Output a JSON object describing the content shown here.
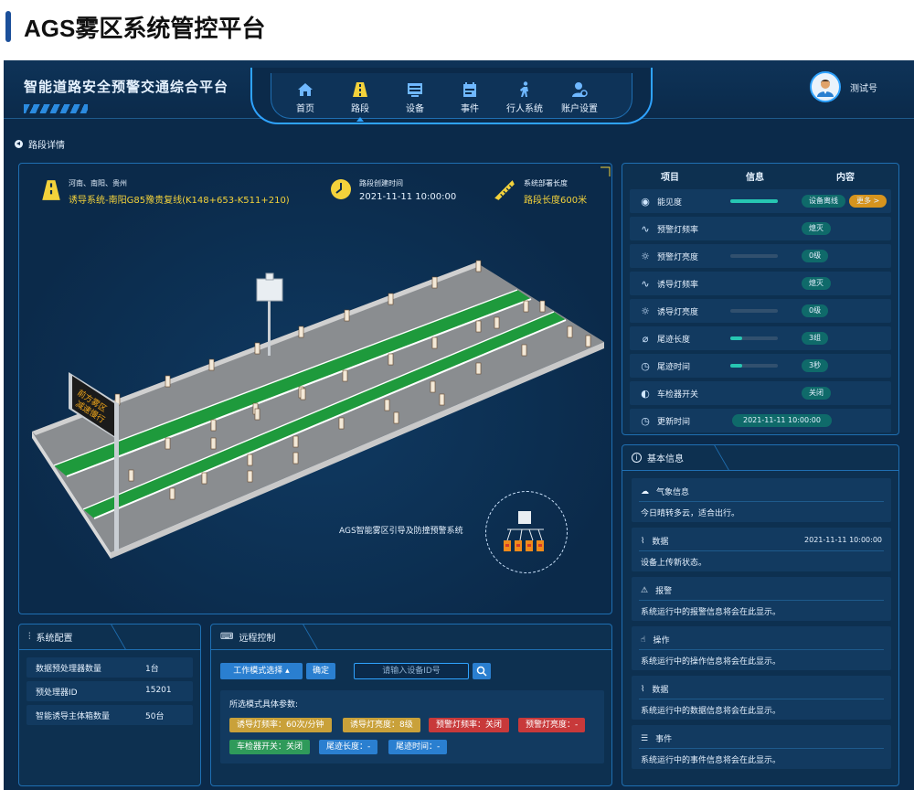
{
  "page_title": "AGS雾区系统管控平台",
  "header": {
    "brand": "智能道路安全预警交通综合平台",
    "nav": [
      {
        "label": "首页",
        "icon": "home-icon"
      },
      {
        "label": "路段",
        "icon": "road-icon",
        "active": true
      },
      {
        "label": "设备",
        "icon": "device-icon"
      },
      {
        "label": "事件",
        "icon": "event-icon"
      },
      {
        "label": "行人系统",
        "icon": "pedestrian-icon"
      },
      {
        "label": "账户设置",
        "icon": "account-icon"
      }
    ],
    "user": "测试号"
  },
  "breadcrumb": "路段详情",
  "main": {
    "region": "河南、南阳、贵州",
    "road": "诱导系统-南阳G85豫贵复线(K148+653-K511+210)",
    "created_label": "路段创建时间",
    "created_value": "2021-11-11 10:00:00",
    "length_label": "系统部署长度",
    "length_value": "路段长度600米",
    "sign_lines": [
      "前方雾区",
      "减速慢行"
    ],
    "ags_label": "AGS智能雾区引导及防撞预警系统"
  },
  "status_table": {
    "headers": [
      "项目",
      "信息",
      "内容"
    ],
    "rows": [
      {
        "icon": "eye-icon",
        "label": "能见度",
        "bar": 1.0,
        "value": "设备离线",
        "more": "更多 >"
      },
      {
        "icon": "pulse-icon",
        "label": "预警灯频率",
        "value": "熄灭"
      },
      {
        "icon": "sun-icon",
        "label": "预警灯亮度",
        "bar": 0.0,
        "value": "0级"
      },
      {
        "icon": "pulse-icon",
        "label": "诱导灯频率",
        "value": "熄灭"
      },
      {
        "icon": "sun-icon",
        "label": "诱导灯亮度",
        "bar": 0.0,
        "value": "0级"
      },
      {
        "icon": "ruler-icon",
        "label": "尾迹长度",
        "bar": 0.25,
        "value": "3组"
      },
      {
        "icon": "clock-icon",
        "label": "尾迹时间",
        "bar": 0.25,
        "value": "3秒"
      },
      {
        "icon": "detector-icon",
        "label": "车检器开关",
        "value": "关闭"
      },
      {
        "icon": "clock-icon",
        "label": "更新时间",
        "value": "2021-11-11 10:00:00"
      }
    ]
  },
  "basic_info": {
    "title": "基本信息",
    "cards": [
      {
        "icon": "weather-icon",
        "title": "气象信息",
        "text": "今日晴转多云，适合出行。"
      },
      {
        "icon": "data-icon",
        "title": "数据",
        "time": "2021-11-11 10:00:00",
        "text": "设备上传新状态。"
      },
      {
        "icon": "alarm-icon",
        "title": "报警",
        "text": "系统运行中的报警信息将会在此显示。"
      },
      {
        "icon": "hand-icon",
        "title": "操作",
        "text": "系统运行中的操作信息将会在此显示。"
      },
      {
        "icon": "data-icon",
        "title": "数据",
        "text": "系统运行中的数据信息将会在此显示。"
      },
      {
        "icon": "event-icon",
        "title": "事件",
        "text": "系统运行中的事件信息将会在此显示。"
      }
    ]
  },
  "system_config": {
    "title": "系统配置",
    "rows": [
      {
        "label": "数据预处理器数量",
        "value": "1台"
      },
      {
        "label": "预处理器ID",
        "value": "15201"
      },
      {
        "label": "智能诱导主体箱数量",
        "value": "50台"
      }
    ]
  },
  "remote": {
    "title": "远程控制",
    "mode_select": "工作模式选择",
    "confirm": "确定",
    "search_placeholder": "请输入设备ID号",
    "params_label": "所选模式具体参数:",
    "tags": [
      {
        "text": "诱导灯频率：60次/分钟",
        "color": "#c9a13a"
      },
      {
        "text": "诱导灯亮度：8级",
        "color": "#c9a13a"
      },
      {
        "text": "预警灯频率：关闭",
        "color": "#c8393a"
      },
      {
        "text": "预警灯亮度：-",
        "color": "#c8393a"
      },
      {
        "text": "车检器开关：关闭",
        "color": "#2f9a5a"
      },
      {
        "text": "尾迹长度：-",
        "color": "#2a7fd0"
      },
      {
        "text": "尾迹时间：-",
        "color": "#2a7fd0"
      }
    ]
  },
  "colors": {
    "accent": "#2fa3ff",
    "teal": "#27c6b2",
    "orange": "#d6941e",
    "yellow": "#f3d23b",
    "bg": "#0b2a4a"
  }
}
